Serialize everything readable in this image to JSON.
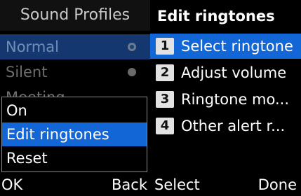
{
  "left_screen": {
    "title": "Sound Profiles",
    "profiles": [
      {
        "label": "Normal",
        "selected": true
      },
      {
        "label": "Silent",
        "selected": false
      },
      {
        "label": "Meeting",
        "selected": false
      }
    ],
    "popup_menu": {
      "items": [
        {
          "label": "On",
          "highlighted": false
        },
        {
          "label": "Edit ringtones",
          "highlighted": true
        },
        {
          "label": "Reset",
          "highlighted": false
        }
      ]
    },
    "softkeys": {
      "left": "OK",
      "right": "Back"
    }
  },
  "right_screen": {
    "title": "Edit ringtones",
    "items": [
      {
        "number": "1",
        "label": "Select ringtone",
        "highlighted": true
      },
      {
        "number": "2",
        "label": "Adjust volume",
        "highlighted": false
      },
      {
        "number": "3",
        "label": "Ringtone mo...",
        "highlighted": false
      },
      {
        "number": "4",
        "label": "Other alert r...",
        "highlighted": false
      }
    ],
    "softkeys": {
      "left": "Select",
      "right": "Done"
    }
  },
  "colors": {
    "highlight": "#1266d6",
    "dim_highlight": "#15376f",
    "background": "#000000"
  }
}
